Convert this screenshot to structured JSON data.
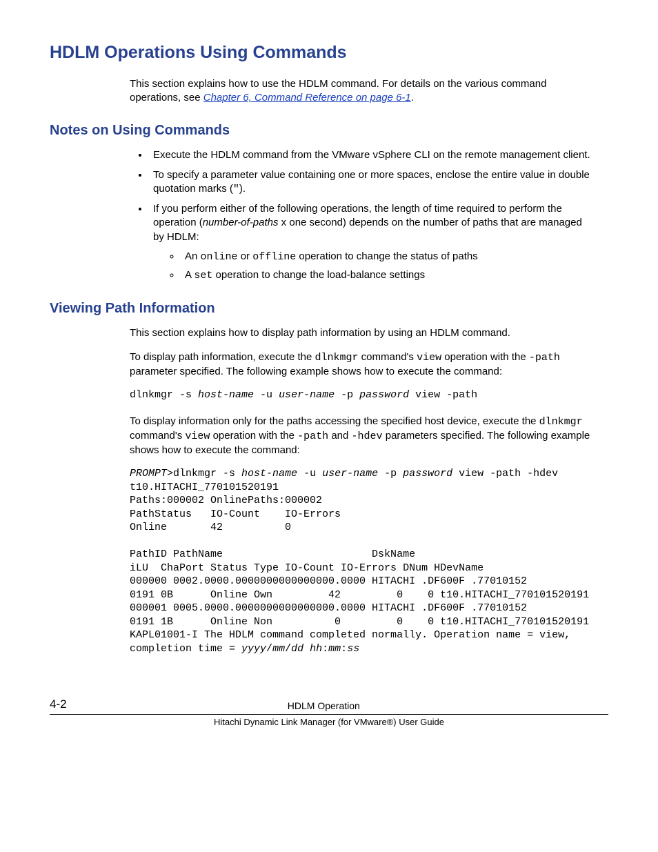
{
  "h1": "HDLM Operations Using Commands",
  "intro_pre": "This section explains how to use the HDLM command. For details on the various command operations, see ",
  "intro_link": "Chapter 6, Command Reference on page 6-1",
  "intro_post": ".",
  "h2_notes": "Notes on Using Commands",
  "notes": {
    "b1": "Execute the HDLM command from the VMware vSphere CLI on the remote management client.",
    "b2_pre": "To specify a parameter value containing one or more spaces, enclose the entire value in double quotation marks (",
    "b2_q": "\"",
    "b2_post": ").",
    "b3_pre": "If you perform either of the following operations, the length of time required to perform the operation (",
    "b3_em": "number-of-paths",
    "b3_post": " x one second) depends on the number of paths that are managed by HDLM:",
    "s1_pre": "An ",
    "s1_c1": "online",
    "s1_mid": " or ",
    "s1_c2": "offline",
    "s1_post": " operation to change the status of paths",
    "s2_pre": "A ",
    "s2_c1": "set",
    "s2_post": " operation to change the load-balance settings"
  },
  "h2_view": "Viewing Path Information",
  "view": {
    "p1": "This section explains how to display path information by using an HDLM command.",
    "p2_pre": "To display path information, execute the ",
    "p2_c1": "dlnkmgr",
    "p2_mid1": " command's ",
    "p2_c2": "view",
    "p2_mid2": " operation with the ",
    "p2_c3": "-path",
    "p2_post": " parameter specified. The following example shows how to execute the command:",
    "cmd1_a": "dlnkmgr -s ",
    "cmd1_h": "host-name",
    "cmd1_b": " -u ",
    "cmd1_u": "user-name",
    "cmd1_c": " -p ",
    "cmd1_p": "password",
    "cmd1_d": " view -path",
    "p3_pre": "To display information only for the paths accessing the specified host device, execute the ",
    "p3_c1": "dlnkmgr",
    "p3_mid1": " command's ",
    "p3_c2": "view",
    "p3_mid2": " operation with the ",
    "p3_c3": "-path",
    "p3_mid3": " and ",
    "p3_c4": "-hdev",
    "p3_post": " parameters specified. The following example shows how to execute the command:",
    "out_prompt": "PROMPT",
    "out_l1a": ">dlnkmgr -s ",
    "out_l1h": "host-name",
    "out_l1b": " -u ",
    "out_l1u": "user-name",
    "out_l1c": " -p ",
    "out_l1p": "password",
    "out_l1d": " view -path -hdev t10.HITACHI_770101520191",
    "out_l2": "Paths:000002 OnlinePaths:000002",
    "out_l3": "PathStatus   IO-Count    IO-Errors",
    "out_l4": "Online       42          0",
    "out_l5": "",
    "out_l6": "PathID PathName                        DskName   ",
    "out_l7": "iLU  ChaPort Status Type IO-Count IO-Errors DNum HDevName",
    "out_l8": "000000 0002.0000.0000000000000000.0000 HITACHI .DF600F .77010152   ",
    "out_l9": "0191 0B      Online Own         42         0    0 t10.HITACHI_770101520191",
    "out_l10": "000001 0005.0000.0000000000000000.0000 HITACHI .DF600F .77010152   ",
    "out_l11": "0191 1B      Online Non          0         0    0 t10.HITACHI_770101520191",
    "out_l12a": "KAPL01001-I The HDLM command completed normally. Operation name = view, completion time = ",
    "out_l12b": "yyyy",
    "out_l12c": "/",
    "out_l12d": "mm",
    "out_l12e": "/",
    "out_l12f": "dd",
    "out_l12g": " ",
    "out_l12h": "hh",
    "out_l12i": ":",
    "out_l12j": "mm",
    "out_l12k": ":",
    "out_l12l": "ss"
  },
  "footer": {
    "page": "4-2",
    "title": "HDLM Operation",
    "sub": "Hitachi Dynamic Link Manager (for VMware®) User Guide"
  }
}
